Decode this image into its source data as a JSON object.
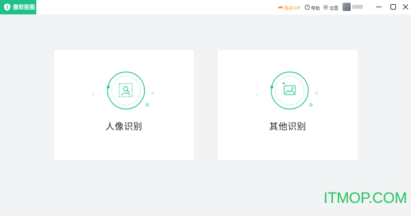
{
  "app": {
    "name": "傲软抠图"
  },
  "header": {
    "vip_label": "购买VIP",
    "help_label": "帮助",
    "settings_label": "设置"
  },
  "cards": [
    {
      "label": "人像识别",
      "icon": "portrait-scan-icon"
    },
    {
      "label": "其他识别",
      "icon": "image-scan-icon"
    }
  ],
  "watermark": "ITMOP.COM",
  "colors": {
    "accent": "#1fc18a",
    "vip": "#f39a21",
    "background": "#f2f3f5"
  }
}
